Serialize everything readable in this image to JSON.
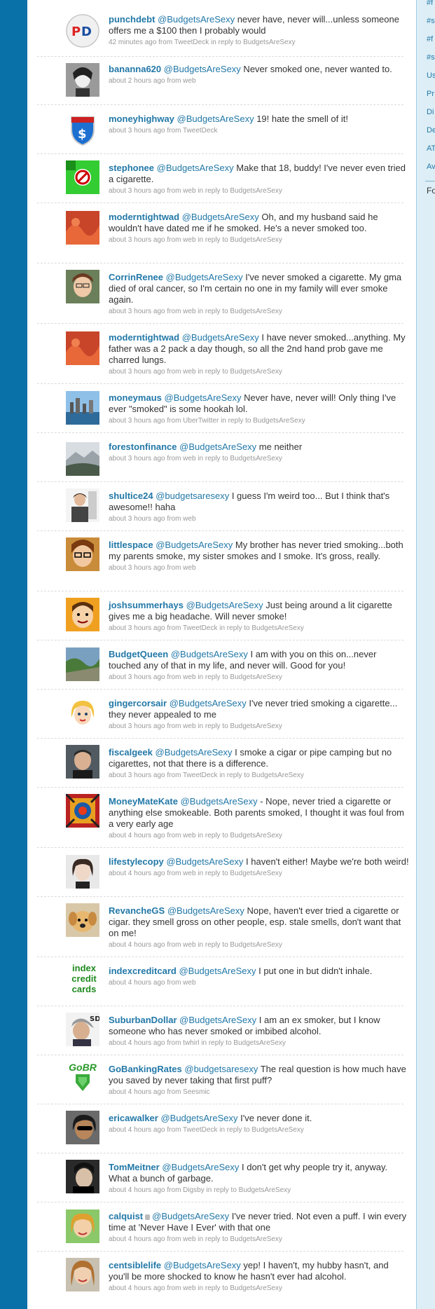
{
  "sidebar": {
    "items": [
      "#f",
      "#s",
      "#f",
      "#s",
      "Us",
      "Pr",
      "Di",
      "De",
      "AT",
      "Av"
    ],
    "follow_label": "Fo"
  },
  "tweets": [
    {
      "user": "punchdebt",
      "mention": "@BudgetsAreSexy",
      "text": " never have, never will...unless someone offers me a $100 then I probably would",
      "meta": "42 minutes ago from TweetDeck in reply to BudgetsAreSexy"
    },
    {
      "user": "bananna620",
      "mention": "@BudgetsAreSexy",
      "text": " Never smoked one, never wanted to.",
      "meta": "about 2 hours ago from web"
    },
    {
      "user": "moneyhighway",
      "mention": "@BudgetsAreSexy",
      "text": " 19! hate the smell of it!",
      "meta": "about 3 hours ago from TweetDeck"
    },
    {
      "user": "stephonee",
      "mention": "@BudgetsAreSexy",
      "text": " Make that 18, buddy! I've never even tried a cigarette.",
      "meta": "about 3 hours ago from web in reply to BudgetsAreSexy"
    },
    {
      "user": "moderntightwad",
      "mention": "@BudgetsAreSexy",
      "text": " Oh, and my husband said he wouldn't have dated me if he smoked. He's a never smoked too.",
      "meta": "about 3 hours ago from web in reply to BudgetsAreSexy"
    },
    {
      "user": "CorrinRenee",
      "mention": "@BudgetsAreSexy",
      "text": " I've never smoked a cigarette. My gma died of oral cancer, so I'm certain no one in my family will ever smoke again.",
      "meta": "about 3 hours ago from web in reply to BudgetsAreSexy"
    },
    {
      "user": "moderntightwad",
      "mention": "@BudgetsAreSexy",
      "text": " I have never smoked...anything. My father was a 2 pack a day though, so all the 2nd hand prob gave me charred lungs.",
      "meta": "about 3 hours ago from web in reply to BudgetsAreSexy"
    },
    {
      "user": "moneymaus",
      "mention": "@BudgetsAreSexy",
      "text": " Never have, never will! Only thing I've ever \"smoked\" is some hookah lol.",
      "meta": "about 3 hours ago from UberTwitter in reply to BudgetsAreSexy"
    },
    {
      "user": "forestonfinance",
      "mention": "@BudgetsAreSexy",
      "text": " me neither",
      "meta": "about 3 hours ago from web in reply to BudgetsAreSexy"
    },
    {
      "user": "shultice24",
      "mention": "@budgetsaresexy",
      "text": " I guess I'm weird too... But I think that's awesome!! haha",
      "meta": "about 3 hours ago from web"
    },
    {
      "user": "littlespace",
      "mention": "@BudgetsAreSexy",
      "text": " My brother has never tried smoking...both my parents smoke, my sister smokes and I smoke. It's gross, really.",
      "meta": "about 3 hours ago from web"
    },
    {
      "user": "joshsummerhays",
      "mention": "@BudgetsAreSexy",
      "text": " Just being around a lit cigarette gives me a big headache. Will never smoke!",
      "meta": "about 3 hours ago from TweetDeck in reply to BudgetsAreSexy"
    },
    {
      "user": "BudgetQueen",
      "mention": "@BudgetsAreSexy",
      "text": " I am with you on this on...never touched any of that in my life, and never will. Good for you!",
      "meta": "about 3 hours ago from web in reply to BudgetsAreSexy"
    },
    {
      "user": "gingercorsair",
      "mention": "@BudgetsAreSexy",
      "text": " I've never tried smoking a cigarette... they never appealed to me",
      "meta": "about 3 hours ago from web in reply to BudgetsAreSexy"
    },
    {
      "user": "fiscalgeek",
      "mention": "@BudgetsAreSexy",
      "text": " I smoke a cigar or pipe camping but no cigarettes, not that there is a difference.",
      "meta": "about 3 hours ago from TweetDeck in reply to BudgetsAreSexy"
    },
    {
      "user": "MoneyMateKate",
      "mention": "@BudgetsAreSexy",
      "text": " - Nope, never tried a cigarette or anything else smokeable. Both parents smoked, I thought it was foul from a very early age",
      "meta": "about 4 hours ago from web in reply to BudgetsAreSexy"
    },
    {
      "user": "lifestylecopy",
      "mention": "@BudgetsAreSexy",
      "text": " I haven't either! Maybe we're both weird!",
      "meta": "about 4 hours ago from web in reply to BudgetsAreSexy"
    },
    {
      "user": "RevancheGS",
      "mention": "@BudgetsAreSexy",
      "text": " Nope, haven't ever tried a cigarette or cigar. they smell gross on other people, esp. stale smells, don't want that on me!",
      "meta": "about 4 hours ago from web in reply to BudgetsAreSexy"
    },
    {
      "user": "indexcreditcard",
      "mention": "@BudgetsAreSexy",
      "text": " I put one in but didn't inhale.",
      "meta": "about 4 hours ago from web",
      "avatar_text": "index credit cards"
    },
    {
      "user": "SuburbanDollar",
      "mention": "@BudgetsAreSexy",
      "text": " I am an ex smoker, but I know someone who has never smoked or imbibed alcohol.",
      "meta": "about 4 hours ago from twhirl in reply to BudgetsAreSexy"
    },
    {
      "user": "GoBankingRates",
      "mention": "@budgetsaresexy",
      "text": " The real question is how much have you saved by never taking that first puff?",
      "meta": "about 4 hours ago from Seesmic",
      "avatar_text": "GoBR"
    },
    {
      "user": "ericawalker",
      "mention": "@BudgetsAreSexy",
      "text": " I've never done it.",
      "meta": "about 4 hours ago from TweetDeck in reply to BudgetsAreSexy"
    },
    {
      "user": "TomMeitner",
      "mention": "@BudgetsAreSexy",
      "text": " I don't get why people try it, anyway. What a bunch of garbage.",
      "meta": "about 4 hours ago from Digsby in reply to BudgetsAreSexy"
    },
    {
      "user": "calquist",
      "mention": "@BudgetsAreSexy",
      "text": " I've never tried. Not even a puff. I win every time at 'Never Have I Ever' with that one",
      "meta": "about 4 hours ago from web in reply to BudgetsAreSexy",
      "locked": true
    },
    {
      "user": "centsiblelife",
      "mention": "@BudgetsAreSexy",
      "text": " yep! I haven't, my hubby hasn't, and you'll be more shocked to know he hasn't ever had alcohol.",
      "meta": "about 4 hours ago from web in reply to BudgetsAreSexy"
    }
  ]
}
